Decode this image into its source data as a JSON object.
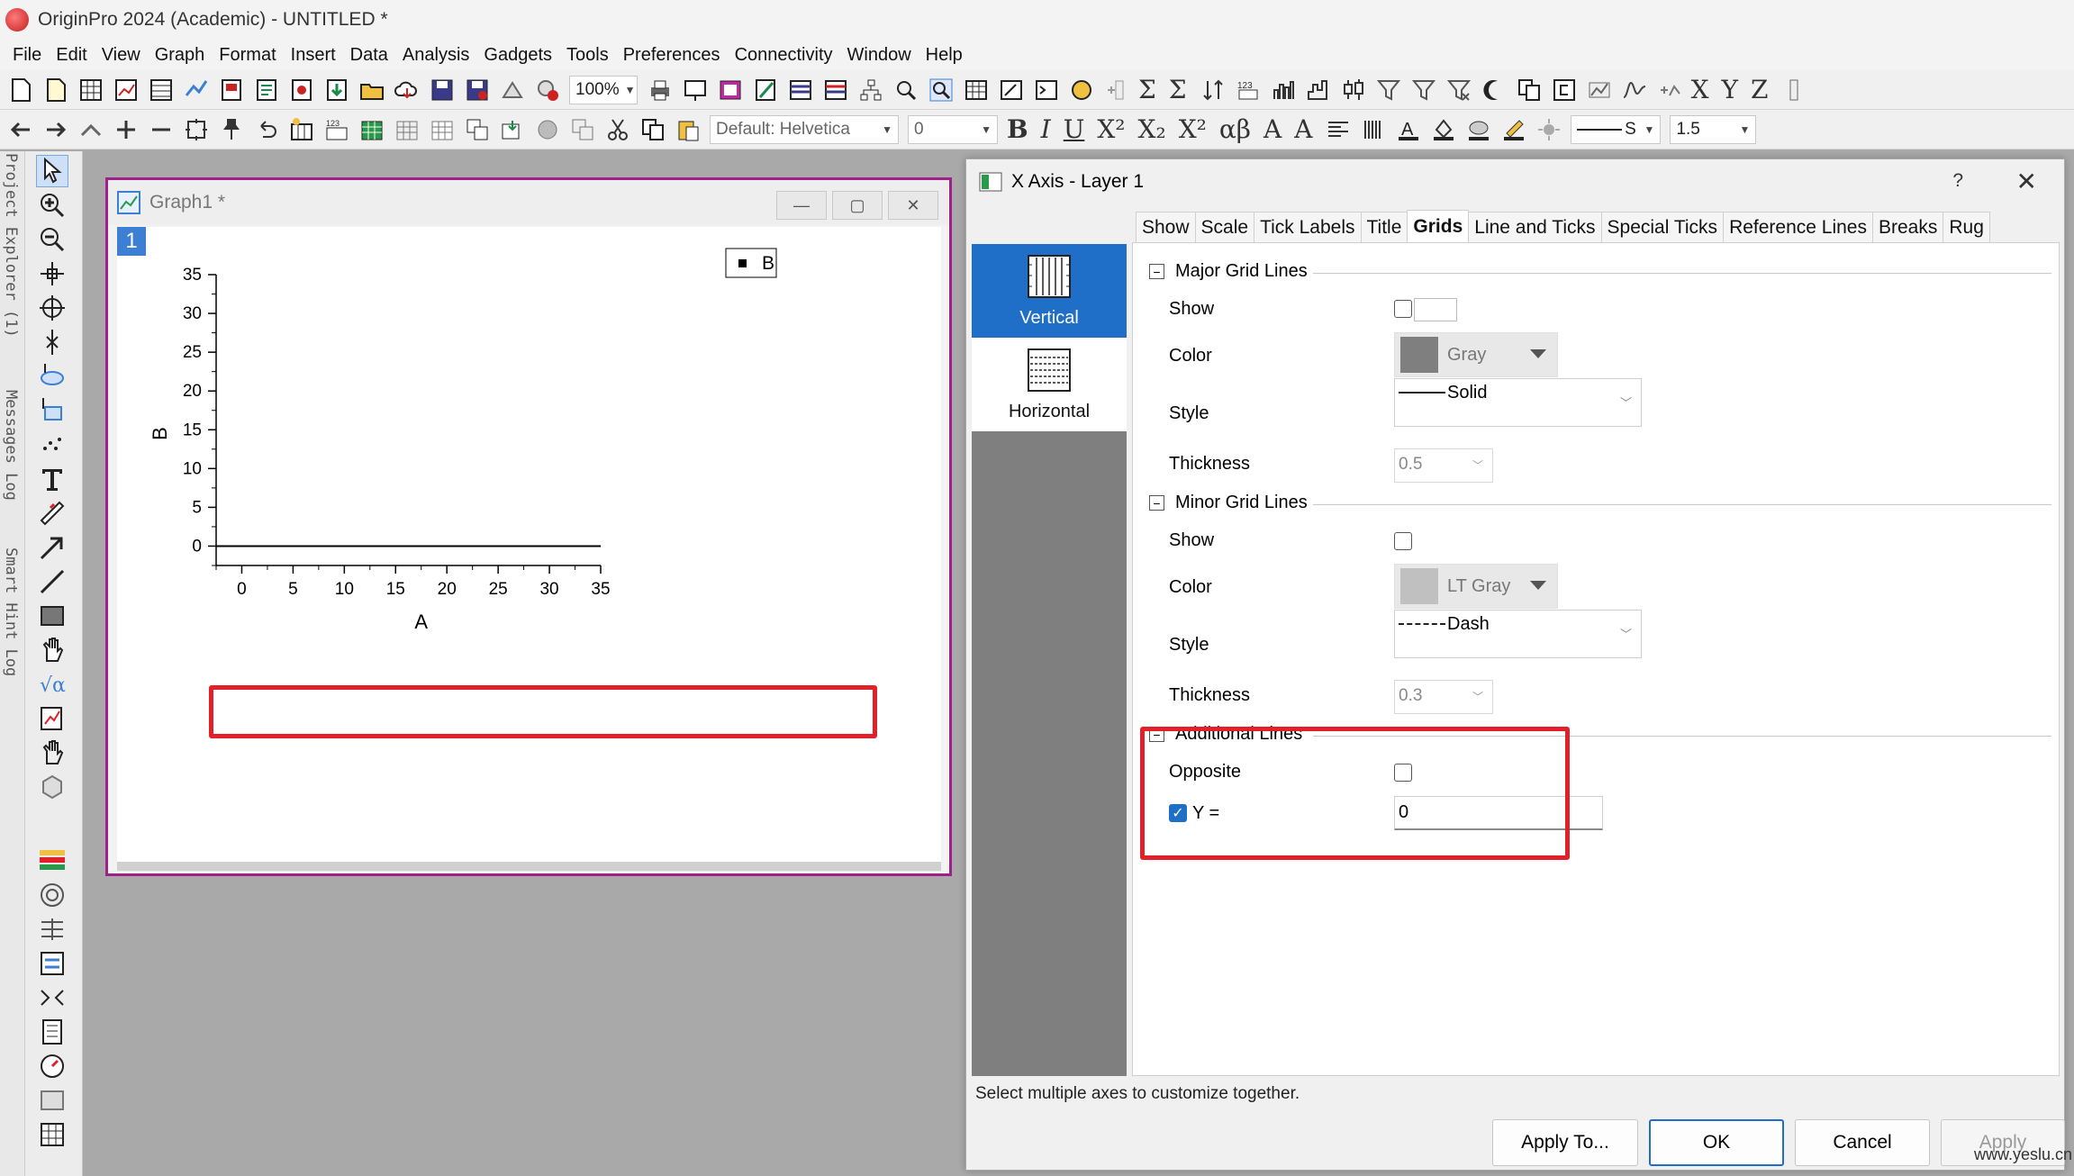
{
  "app": {
    "title": "OriginPro 2024 (Academic) - UNTITLED *"
  },
  "menu": [
    "File",
    "Edit",
    "View",
    "Graph",
    "Format",
    "Insert",
    "Data",
    "Analysis",
    "Gadgets",
    "Tools",
    "Preferences",
    "Connectivity",
    "Window",
    "Help"
  ],
  "toolbar": {
    "zoom_value": "100%",
    "font_value": "Default: Helvetica",
    "font_size_value": "0",
    "line_style_value": "S",
    "line_width_value": "1.5",
    "axis_letters": [
      "X",
      "Y",
      "Z"
    ]
  },
  "side_tabs": [
    "Project Explorer (1)",
    "Messages Log",
    "Smart Hint Log"
  ],
  "graph_window": {
    "title": "Graph1 *",
    "layer_number": "1",
    "legend_label": "B",
    "xlabel": "A",
    "ylabel": "B",
    "x_ticks": [
      "0",
      "5",
      "10",
      "15",
      "20",
      "25",
      "30",
      "35"
    ],
    "y_ticks": [
      "0",
      "5",
      "10",
      "15",
      "20",
      "25",
      "30",
      "35"
    ]
  },
  "chart_data": {
    "type": "line",
    "title": "",
    "xlabel": "A",
    "ylabel": "B",
    "xlim": [
      -2.5,
      35
    ],
    "ylim": [
      -2.5,
      35
    ],
    "legend": [
      "B"
    ],
    "legend_position": "top-right",
    "grid": false,
    "series": [
      {
        "name": "B",
        "x": [
          -2.5,
          35
        ],
        "y": [
          0,
          0
        ]
      }
    ]
  },
  "dialog": {
    "title": "X Axis - Layer 1",
    "help": "?",
    "close": "✕",
    "tabs": [
      "Show",
      "Scale",
      "Tick Labels",
      "Title",
      "Grids",
      "Line and Ticks",
      "Special Ticks",
      "Reference Lines",
      "Breaks",
      "Rug"
    ],
    "active_tab": "Grids",
    "side_items": [
      "Vertical",
      "Horizontal"
    ],
    "major": {
      "header": "Major Grid Lines",
      "show_label": "Show",
      "color_label": "Color",
      "color_value": "Gray",
      "color_hex": "#7f7f7f",
      "style_label": "Style",
      "style_value": "Solid",
      "thickness_label": "Thickness",
      "thickness_value": "0.5"
    },
    "minor": {
      "header": "Minor Grid Lines",
      "show_label": "Show",
      "color_label": "Color",
      "color_value": "LT Gray",
      "color_hex": "#c0c0c0",
      "style_label": "Style",
      "style_value": "Dash",
      "thickness_label": "Thickness",
      "thickness_value": "0.3"
    },
    "additional": {
      "header": "Additional Lines",
      "opposite_label": "Opposite",
      "y_label": "Y =",
      "y_value": "0"
    },
    "status": "Select multiple axes to customize together.",
    "buttons": {
      "apply_to": "Apply To...",
      "ok": "OK",
      "cancel": "Cancel",
      "apply": "Apply"
    }
  },
  "watermark": "www.yeslu.cn"
}
